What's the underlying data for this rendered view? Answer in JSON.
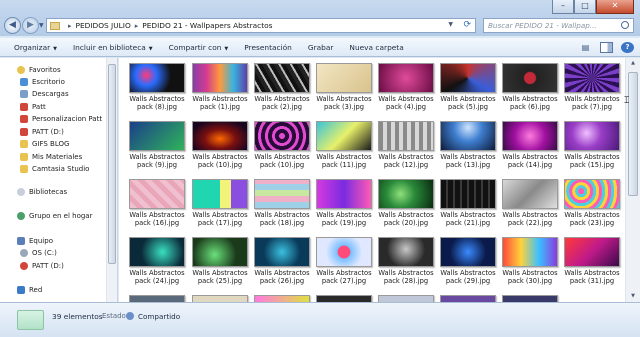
{
  "window": {
    "controls": [
      "–",
      "□",
      "✕"
    ]
  },
  "navigation": {
    "back_glyph": "◀",
    "forward_glyph": "▶",
    "breadcrumb": [
      "PEDIDOS JULIO",
      "PEDIDO 21 - Wallpapers Abstractos"
    ],
    "separator": "▸",
    "search_placeholder": "Buscar PEDIDO 21 - Wallpap..."
  },
  "toolbar": {
    "organize_label": "Organizar",
    "include_label": "Incluir en biblioteca",
    "share_label": "Compartir con",
    "presentation_label": "Presentación",
    "burn_label": "Grabar",
    "new_folder_label": "Nueva carpeta",
    "caret": "▼"
  },
  "sidebar": {
    "favorites_label": "Favoritos",
    "favorites": [
      {
        "label": "Escritorio",
        "color": "#4d8fd6"
      },
      {
        "label": "Descargas",
        "color": "#7a9ec8"
      },
      {
        "label": "Patt",
        "color": "#d2453a"
      },
      {
        "label": "Personalizacion Patt",
        "color": "#d2453a"
      },
      {
        "label": "PATT (D:)",
        "color": "#d2453a"
      },
      {
        "label": "GIFS BLOG",
        "color": "#e8c34f"
      },
      {
        "label": "Mis Materiales",
        "color": "#e8c34f"
      },
      {
        "label": "Camtasia Studio",
        "color": "#e8c34f"
      }
    ],
    "libraries_label": "Bibliotecas",
    "homegroup_label": "Grupo en el hogar",
    "computer_label": "Equipo",
    "drives": [
      {
        "label": "OS (C:)",
        "color": "#9aa7b8"
      },
      {
        "label": "PATT (D:)",
        "color": "#d2453a"
      }
    ],
    "network_label": "Red"
  },
  "files": [
    {
      "line1": "Walls Abstractos",
      "line2": "pack (8).jpg",
      "bg": "radial-gradient(circle at 30% 40%, #ff3b7a 0, #2a6cff 25%, #111 60%)"
    },
    {
      "line1": "Walls Abstractos",
      "line2": "pack (1).jpg",
      "bg": "linear-gradient(90deg, #8a3ea8, #d43c8e, #ff9a3c, #36b4e0, #5f3fa8)"
    },
    {
      "line1": "Walls Abstractos",
      "line2": "pack (2).jpg",
      "bg": "repeating-linear-gradient(60deg, #222 0 4px, #bdbdbd 4px 6px, #111 6px 10px)"
    },
    {
      "line1": "Walls Abstractos",
      "line2": "pack (3).jpg",
      "bg": "linear-gradient(135deg, #f2e6c2, #d9c38d)"
    },
    {
      "line1": "Walls Abstractos",
      "line2": "pack (4).jpg",
      "bg": "radial-gradient(circle, #e04b9a, #6a0c44)"
    },
    {
      "line1": "Walls Abstractos",
      "line2": "pack (5).jpg",
      "bg": "conic-gradient(#c9332c, #3a5ed8, #111, #c9332c)"
    },
    {
      "line1": "Walls Abstractos",
      "line2": "pack (6).jpg",
      "bg": "radial-gradient(circle, #c22a3a 0 18%, #222 22%, #333 100%)"
    },
    {
      "line1": "Walls Abstractos",
      "line2": "pack (7).jpg",
      "bg": "repeating-conic-gradient(#2a1050 0 10deg, #7a3ec8 10deg 20deg)"
    },
    {
      "line1": "Walls Abstractos",
      "line2": "pack (9).jpg",
      "bg": "linear-gradient(135deg, #1b3f8a, #2fb45a)"
    },
    {
      "line1": "Walls Abstractos",
      "line2": "pack (10).jpg",
      "bg": "radial-gradient(ellipse at 50% 60%, #ff6a00, #7a1010 40%, #1a0520 80%)"
    },
    {
      "line1": "Walls Abstractos",
      "line2": "pack (10).jpg",
      "bg": "repeating-radial-gradient(circle, #e04bd0 0 3px, #2a0a3a 3px 7px)"
    },
    {
      "line1": "Walls Abstractos",
      "line2": "pack (11).jpg",
      "bg": "linear-gradient(135deg, #3ac4d8, #e8f06a, #1a1a1a)"
    },
    {
      "line1": "Walls Abstractos",
      "line2": "pack (12).jpg",
      "bg": "repeating-linear-gradient(90deg, #8a8a8a 0 4px, #d8d8d8 4px 8px)"
    },
    {
      "line1": "Walls Abstractos",
      "line2": "pack (13).jpg",
      "bg": "radial-gradient(circle at 50% 20%, #cfe4ff, #3f7fd0 40%, #0c1a3a)"
    },
    {
      "line1": "Walls Abstractos",
      "line2": "pack (14).jpg",
      "bg": "radial-gradient(circle, #ff7ae0, #a011a0 50%, #3a0a4a)"
    },
    {
      "line1": "Walls Abstractos",
      "line2": "pack (15).jpg",
      "bg": "radial-gradient(circle at 40% 40%, #f0c0ff, #9a3ec8 40%, #4a1a7a)"
    },
    {
      "line1": "Walls Abstractos",
      "line2": "pack (16).jpg",
      "bg": "repeating-linear-gradient(45deg, #f0c0d0 0 5px, #e8a6b8 5px 10px)"
    },
    {
      "line1": "Walls Abstractos",
      "line2": "pack (17).jpg",
      "bg": "linear-gradient(90deg, #1fd6b0 0 50%, #f3f37a 50% 70%, #8a4ee0 70%)"
    },
    {
      "line1": "Walls Abstractos",
      "line2": "pack (18).jpg",
      "bg": "repeating-linear-gradient(0deg, #9ed0e8 0 6px, #f0b0c8 6px 12px, #c8e8a0 12px 18px)"
    },
    {
      "line1": "Walls Abstractos",
      "line2": "pack (19).jpg",
      "bg": "linear-gradient(90deg, #d63ae0, #7a2be0, #ff5ab4)"
    },
    {
      "line1": "Walls Abstractos",
      "line2": "pack (20).jpg",
      "bg": "radial-gradient(circle at 40% 50%, #8ee07a, #2a8a3a 40%, #0a2a10)"
    },
    {
      "line1": "Walls Abstractos",
      "line2": "pack (21).jpg",
      "bg": "repeating-linear-gradient(90deg, #111 0 5px, #3a3a3a 5px 7px)"
    },
    {
      "line1": "Walls Abstractos",
      "line2": "pack (22).jpg",
      "bg": "linear-gradient(135deg, #d8d8d8, #8a8a8a, #e0e0e0)"
    },
    {
      "line1": "Walls Abstractos",
      "line2": "pack (23).jpg",
      "bg": "repeating-radial-gradient(circle at 30% 40%, #ff5ab4 0 3px, #4ad0e0 3px 6px, #ffd23a 6px 9px)"
    },
    {
      "line1": "Walls Abstractos",
      "line2": "pack (24).jpg",
      "bg": "radial-gradient(circle at 60% 50%, #3ae0c0, #0a2a3a 60%)"
    },
    {
      "line1": "Walls Abstractos",
      "line2": "pack (25).jpg",
      "bg": "radial-gradient(circle at 40% 60%, #6ae07a, #1a3a1a 60%)"
    },
    {
      "line1": "Walls Abstractos",
      "line2": "pack (26).jpg",
      "bg": "radial-gradient(circle, #3ac0e0, #0a3a5a 60%)"
    },
    {
      "line1": "Walls Abstractos",
      "line2": "pack (27).jpg",
      "bg": "radial-gradient(circle, #ff4a7a 0 20%, #7ac0ff 22%, #e0e8ff 60%)"
    },
    {
      "line1": "Walls Abstractos",
      "line2": "pack (28).jpg",
      "bg": "radial-gradient(circle at 50% 40%, #c8c8c8, #2a2a2a 60%)"
    },
    {
      "line1": "Walls Abstractos",
      "line2": "pack (29).jpg",
      "bg": "radial-gradient(circle at 50% 50%, #3a8aff, #0a1a4a 60%)"
    },
    {
      "line1": "Walls Abstractos",
      "line2": "pack (30).jpg",
      "bg": "linear-gradient(90deg, #ff4a3a, #ffd23a, #3ac0ff, #8a3ae0)"
    },
    {
      "line1": "Walls Abstractos",
      "line2": "pack (31).jpg",
      "bg": "linear-gradient(135deg, #ff3a3a, #c01a8a, #3a0a4a)"
    },
    {
      "line1": "",
      "line2": "",
      "bg": "#5a6a7a"
    },
    {
      "line1": "",
      "line2": "",
      "bg": "#e0d8c0"
    },
    {
      "line1": "",
      "line2": "",
      "bg": "linear-gradient(90deg, #ff7ae0, #e0e040)"
    },
    {
      "line1": "",
      "line2": "",
      "bg": "#2a2a2a"
    },
    {
      "line1": "",
      "line2": "",
      "bg": "#c0c8d8"
    },
    {
      "line1": "",
      "line2": "",
      "bg": "#6a4aa0"
    },
    {
      "line1": "",
      "line2": "",
      "bg": "#3a3a6a"
    }
  ],
  "status": {
    "count": "39 elementos",
    "state_label": "Estado:",
    "state_value": "Compartido"
  }
}
